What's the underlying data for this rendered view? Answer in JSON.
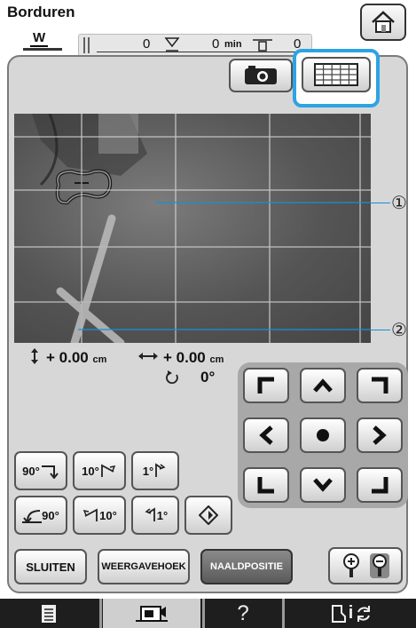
{
  "header": {
    "title": "Borduren",
    "presser_foot": "W",
    "status": {
      "count1": "0",
      "time_value": "0",
      "time_unit": "min",
      "count2": "0"
    }
  },
  "readout": {
    "vertical_value": "+ 0.00",
    "vertical_unit": "cm",
    "horizontal_value": "+ 0.00",
    "horizontal_unit": "cm",
    "rotation_value": "0°"
  },
  "callouts": {
    "c1": "①",
    "c2": "②"
  },
  "rotate_buttons": {
    "r90_cw": "90°",
    "r10_cw": "10°",
    "r1_cw": "1°",
    "r90_ccw": "90°",
    "r10_ccw": "10°",
    "r1_ccw": "1°"
  },
  "actions": {
    "close": "SLUITEN",
    "view_angle": "WEERGAVEHOEK",
    "needle_position": "NAALDPOSITIE"
  },
  "bottom_bar": {
    "help": "?",
    "info": "i"
  },
  "colors": {
    "highlight": "#2ea3e3",
    "panel": "#d7d7d7"
  }
}
